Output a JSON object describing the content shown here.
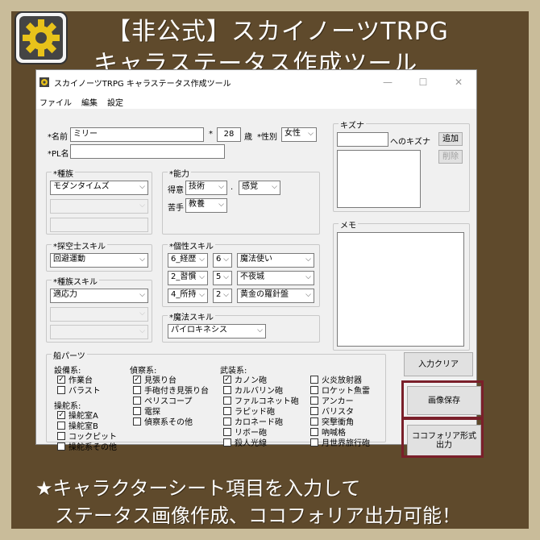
{
  "promo": {
    "title_line1": "【非公式】スカイノーツTRPG",
    "title_line2": "キャラステータス作成ツール",
    "footer_line1": "★キャラクターシート項目を入力して",
    "footer_line2": "ステータス画像作成、ココフォリア出力可能！"
  },
  "window": {
    "title": "スカイノーツTRPG キャラステータス作成ツール",
    "minimize": "—",
    "maximize": "☐",
    "close": "✕",
    "menu": [
      "ファイル",
      "編集",
      "設定"
    ]
  },
  "profile": {
    "name_label": "*名前",
    "name_value": "ミリー",
    "age_label": "*",
    "age_value": "28",
    "age_unit": "歳",
    "gender_label": "*性別",
    "gender_value": "女性",
    "pl_label": "*PL名",
    "pl_value": ""
  },
  "race": {
    "title": "*種族",
    "value": "モダンタイムズ",
    "sub_value": "",
    "text_value": ""
  },
  "ability": {
    "title": "*能力",
    "good_label": "得意",
    "good_value": "技術",
    "sep": ".",
    "good_value2": "感覚",
    "bad_label": "苦手",
    "bad_value": "教養"
  },
  "explorer_skill": {
    "title": "*探空士スキル",
    "value": "回避運動"
  },
  "race_skill": {
    "title": "*種族スキル",
    "value": "適応力",
    "value2": "",
    "value3": ""
  },
  "personal_skill": {
    "title": "*個性スキル",
    "rows": [
      {
        "cat": "6_経歴",
        "num": "6",
        "name": "魔法使い"
      },
      {
        "cat": "2_習慣",
        "num": "5",
        "name": "不夜城"
      },
      {
        "cat": "4_所持",
        "num": "2",
        "name": "黄金の羅針盤"
      }
    ]
  },
  "magic_skill": {
    "title": "*魔法スキル",
    "value": "パイロキネシス"
  },
  "kizuna": {
    "title": "キズナ",
    "input_value": "",
    "to_label": "へのキズナ",
    "add_button": "追加",
    "delete_button": "削除"
  },
  "memo": {
    "title": "メモ",
    "value": ""
  },
  "ship_parts": {
    "title": "船パーツ",
    "groups": [
      {
        "title": "設備系:",
        "items": [
          {
            "label": "作業台",
            "checked": true
          },
          {
            "label": "バラスト",
            "checked": false
          }
        ]
      },
      {
        "title": "操舵系:",
        "items": [
          {
            "label": "操舵室A",
            "checked": true
          },
          {
            "label": "操舵室B",
            "checked": false
          },
          {
            "label": "コックピット",
            "checked": false
          },
          {
            "label": "操舵系その他",
            "checked": false
          }
        ]
      },
      {
        "title": "偵察系:",
        "items": [
          {
            "label": "見張り台",
            "checked": true
          },
          {
            "label": "手砲付き見張り台",
            "checked": false
          },
          {
            "label": "ペリスコープ",
            "checked": false
          },
          {
            "label": "電探",
            "checked": false
          },
          {
            "label": "偵察系その他",
            "checked": false
          }
        ]
      },
      {
        "title": "武装系:",
        "items": [
          {
            "label": "カノン砲",
            "checked": true
          },
          {
            "label": "カルバリン砲",
            "checked": false
          },
          {
            "label": "ファルコネット砲",
            "checked": false
          },
          {
            "label": "ラピッド砲",
            "checked": false
          },
          {
            "label": "カロネード砲",
            "checked": false
          },
          {
            "label": "リボー砲",
            "checked": false
          },
          {
            "label": "殺人光線",
            "checked": false
          }
        ]
      },
      {
        "title": "",
        "items": [
          {
            "label": "火炎放射器",
            "checked": false
          },
          {
            "label": "ロケット魚雷",
            "checked": false
          },
          {
            "label": "アンカー",
            "checked": false
          },
          {
            "label": "バリスタ",
            "checked": false
          },
          {
            "label": "突撃衝角",
            "checked": false
          },
          {
            "label": "吶喊格",
            "checked": false
          },
          {
            "label": "月世界旅行砲",
            "checked": false
          }
        ]
      }
    ]
  },
  "actions": {
    "clear": "入力クリア",
    "save_image": "画像保存",
    "export_line1": "ココフォリア形式",
    "export_line2": "出力"
  },
  "colors": {
    "background": "#c9bc9a",
    "panel": "#5f4a2c",
    "highlight": "#7a1f2a",
    "logo_gear": "#e8c21a"
  },
  "icons": {
    "logo": "gear-icon",
    "dropdown": "chevron-down-icon",
    "check": "check-icon"
  }
}
